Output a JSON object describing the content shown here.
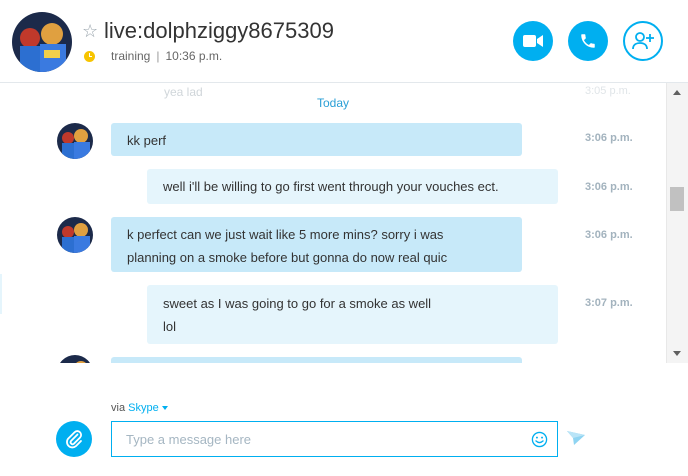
{
  "header": {
    "contact_name": "live:dolphziggy8675309",
    "status_text": "training",
    "separator": "|",
    "local_time": "10:36 p.m.",
    "icons": {
      "favorite": "star-icon",
      "status": "clock-icon",
      "video_call": "video-camera-icon",
      "audio_call": "phone-icon",
      "add_people": "add-user-icon"
    }
  },
  "conversation": {
    "ghost_previous": {
      "text": "yea lad",
      "time": "3:05 p.m."
    },
    "date_divider": "Today",
    "messages": [
      {
        "direction": "incoming",
        "lines": [
          "kk perf"
        ],
        "time": "3:06 p.m."
      },
      {
        "direction": "outgoing",
        "lines": [
          "well i'll be willing to go first went through your vouches ect."
        ],
        "time": "3:06 p.m."
      },
      {
        "direction": "incoming",
        "lines": [
          "k perfect can we just wait like 5 more mins? sorry i was",
          "planning on a smoke before but gonna do now real quic"
        ],
        "time": "3:06 p.m."
      },
      {
        "direction": "outgoing",
        "lines": [
          "sweet as I was going to go for a smoke as well",
          "lol"
        ],
        "time": "3:07 p.m."
      }
    ]
  },
  "composer": {
    "via_label": "via",
    "via_service": "Skype",
    "placeholder": "Type a message here",
    "value": "",
    "icons": {
      "attach": "paperclip-icon",
      "emoji": "smiley-icon",
      "send": "send-arrow-icon"
    }
  },
  "colors": {
    "accent": "#00aff0",
    "incoming_bubble": "#c7e9f9",
    "outgoing_bubble": "#e5f5fc",
    "timestamp": "#a3b3be",
    "status_away": "#f7c400"
  }
}
